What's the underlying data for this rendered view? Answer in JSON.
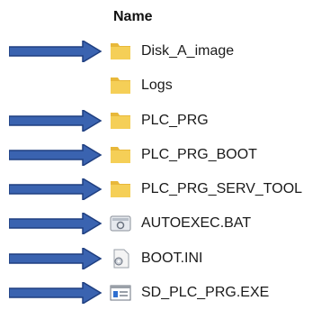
{
  "header": {
    "name_label": "Name"
  },
  "files": [
    {
      "name": "Disk_A_image",
      "icon": "folder-icon",
      "marked": true
    },
    {
      "name": "Logs",
      "icon": "folder-icon",
      "marked": false
    },
    {
      "name": "PLC_PRG",
      "icon": "folder-icon",
      "marked": true
    },
    {
      "name": "PLC_PRG_BOOT",
      "icon": "folder-icon",
      "marked": true
    },
    {
      "name": "PLC_PRG_SERV_TOOL",
      "icon": "folder-icon",
      "marked": true
    },
    {
      "name": "AUTOEXEC.BAT",
      "icon": "batch-file-icon",
      "marked": true
    },
    {
      "name": "BOOT.INI",
      "icon": "settings-file-icon",
      "marked": true
    },
    {
      "name": "SD_PLC_PRG.EXE",
      "icon": "executable-icon",
      "marked": true
    }
  ],
  "colors": {
    "arrow": "#3a63b0",
    "arrow_outline": "#1f3f80",
    "folder": "#f5cf57",
    "folder_tab": "#e8b83a"
  }
}
